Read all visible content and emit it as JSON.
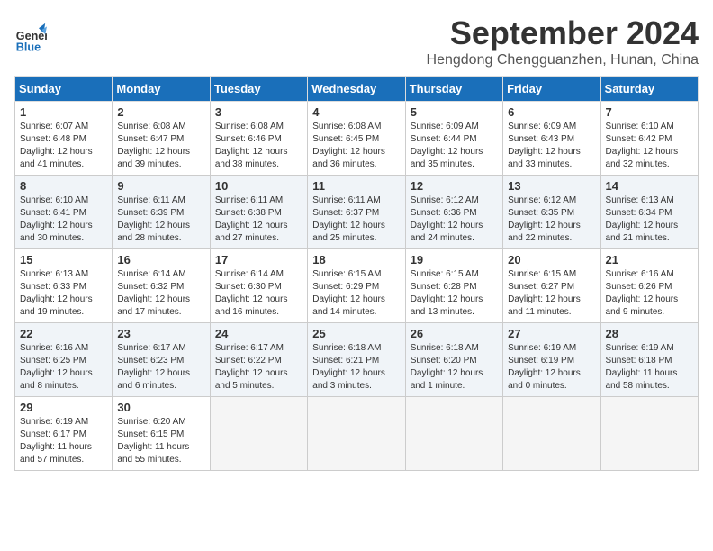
{
  "logo": {
    "line1": "General",
    "line2": "Blue"
  },
  "title": "September 2024",
  "location": "Hengdong Chengguanzhen, Hunan, China",
  "days_header": [
    "Sunday",
    "Monday",
    "Tuesday",
    "Wednesday",
    "Thursday",
    "Friday",
    "Saturday"
  ],
  "weeks": [
    [
      {
        "day": "1",
        "rise": "Sunrise: 6:07 AM",
        "set": "Sunset: 6:48 PM",
        "daylight": "Daylight: 12 hours and 41 minutes."
      },
      {
        "day": "2",
        "rise": "Sunrise: 6:08 AM",
        "set": "Sunset: 6:47 PM",
        "daylight": "Daylight: 12 hours and 39 minutes."
      },
      {
        "day": "3",
        "rise": "Sunrise: 6:08 AM",
        "set": "Sunset: 6:46 PM",
        "daylight": "Daylight: 12 hours and 38 minutes."
      },
      {
        "day": "4",
        "rise": "Sunrise: 6:08 AM",
        "set": "Sunset: 6:45 PM",
        "daylight": "Daylight: 12 hours and 36 minutes."
      },
      {
        "day": "5",
        "rise": "Sunrise: 6:09 AM",
        "set": "Sunset: 6:44 PM",
        "daylight": "Daylight: 12 hours and 35 minutes."
      },
      {
        "day": "6",
        "rise": "Sunrise: 6:09 AM",
        "set": "Sunset: 6:43 PM",
        "daylight": "Daylight: 12 hours and 33 minutes."
      },
      {
        "day": "7",
        "rise": "Sunrise: 6:10 AM",
        "set": "Sunset: 6:42 PM",
        "daylight": "Daylight: 12 hours and 32 minutes."
      }
    ],
    [
      {
        "day": "8",
        "rise": "Sunrise: 6:10 AM",
        "set": "Sunset: 6:41 PM",
        "daylight": "Daylight: 12 hours and 30 minutes."
      },
      {
        "day": "9",
        "rise": "Sunrise: 6:11 AM",
        "set": "Sunset: 6:39 PM",
        "daylight": "Daylight: 12 hours and 28 minutes."
      },
      {
        "day": "10",
        "rise": "Sunrise: 6:11 AM",
        "set": "Sunset: 6:38 PM",
        "daylight": "Daylight: 12 hours and 27 minutes."
      },
      {
        "day": "11",
        "rise": "Sunrise: 6:11 AM",
        "set": "Sunset: 6:37 PM",
        "daylight": "Daylight: 12 hours and 25 minutes."
      },
      {
        "day": "12",
        "rise": "Sunrise: 6:12 AM",
        "set": "Sunset: 6:36 PM",
        "daylight": "Daylight: 12 hours and 24 minutes."
      },
      {
        "day": "13",
        "rise": "Sunrise: 6:12 AM",
        "set": "Sunset: 6:35 PM",
        "daylight": "Daylight: 12 hours and 22 minutes."
      },
      {
        "day": "14",
        "rise": "Sunrise: 6:13 AM",
        "set": "Sunset: 6:34 PM",
        "daylight": "Daylight: 12 hours and 21 minutes."
      }
    ],
    [
      {
        "day": "15",
        "rise": "Sunrise: 6:13 AM",
        "set": "Sunset: 6:33 PM",
        "daylight": "Daylight: 12 hours and 19 minutes."
      },
      {
        "day": "16",
        "rise": "Sunrise: 6:14 AM",
        "set": "Sunset: 6:32 PM",
        "daylight": "Daylight: 12 hours and 17 minutes."
      },
      {
        "day": "17",
        "rise": "Sunrise: 6:14 AM",
        "set": "Sunset: 6:30 PM",
        "daylight": "Daylight: 12 hours and 16 minutes."
      },
      {
        "day": "18",
        "rise": "Sunrise: 6:15 AM",
        "set": "Sunset: 6:29 PM",
        "daylight": "Daylight: 12 hours and 14 minutes."
      },
      {
        "day": "19",
        "rise": "Sunrise: 6:15 AM",
        "set": "Sunset: 6:28 PM",
        "daylight": "Daylight: 12 hours and 13 minutes."
      },
      {
        "day": "20",
        "rise": "Sunrise: 6:15 AM",
        "set": "Sunset: 6:27 PM",
        "daylight": "Daylight: 12 hours and 11 minutes."
      },
      {
        "day": "21",
        "rise": "Sunrise: 6:16 AM",
        "set": "Sunset: 6:26 PM",
        "daylight": "Daylight: 12 hours and 9 minutes."
      }
    ],
    [
      {
        "day": "22",
        "rise": "Sunrise: 6:16 AM",
        "set": "Sunset: 6:25 PM",
        "daylight": "Daylight: 12 hours and 8 minutes."
      },
      {
        "day": "23",
        "rise": "Sunrise: 6:17 AM",
        "set": "Sunset: 6:23 PM",
        "daylight": "Daylight: 12 hours and 6 minutes."
      },
      {
        "day": "24",
        "rise": "Sunrise: 6:17 AM",
        "set": "Sunset: 6:22 PM",
        "daylight": "Daylight: 12 hours and 5 minutes."
      },
      {
        "day": "25",
        "rise": "Sunrise: 6:18 AM",
        "set": "Sunset: 6:21 PM",
        "daylight": "Daylight: 12 hours and 3 minutes."
      },
      {
        "day": "26",
        "rise": "Sunrise: 6:18 AM",
        "set": "Sunset: 6:20 PM",
        "daylight": "Daylight: 12 hours and 1 minute."
      },
      {
        "day": "27",
        "rise": "Sunrise: 6:19 AM",
        "set": "Sunset: 6:19 PM",
        "daylight": "Daylight: 12 hours and 0 minutes."
      },
      {
        "day": "28",
        "rise": "Sunrise: 6:19 AM",
        "set": "Sunset: 6:18 PM",
        "daylight": "Daylight: 11 hours and 58 minutes."
      }
    ],
    [
      {
        "day": "29",
        "rise": "Sunrise: 6:19 AM",
        "set": "Sunset: 6:17 PM",
        "daylight": "Daylight: 11 hours and 57 minutes."
      },
      {
        "day": "30",
        "rise": "Sunrise: 6:20 AM",
        "set": "Sunset: 6:15 PM",
        "daylight": "Daylight: 11 hours and 55 minutes."
      },
      null,
      null,
      null,
      null,
      null
    ]
  ]
}
